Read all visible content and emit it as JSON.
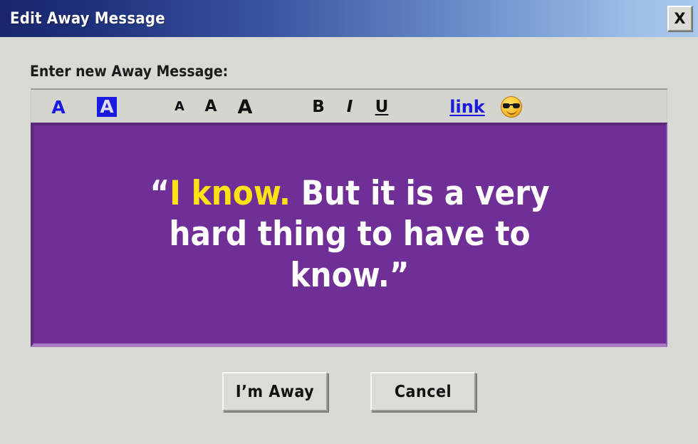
{
  "window": {
    "title": "Edit Away Message",
    "close_label": "X",
    "titlebar_gradient_from": "#19266b",
    "titlebar_gradient_to": "#a9c8ec",
    "body_background": "#d9d9d3"
  },
  "form": {
    "prompt_label": "Enter new Away Message:"
  },
  "toolbar": {
    "font_color_label": "A",
    "background_color_label": "A",
    "size_small_label": "A",
    "size_medium_label": "A",
    "size_large_label": "A",
    "bold_label": "B",
    "italic_label": "I",
    "underline_label": "U",
    "link_label": "link",
    "emoji_label": "sunglasses-smiley",
    "accent_color": "#1a1ae0",
    "background": "#d5d5cf"
  },
  "message": {
    "background_color": "#6f2f96",
    "default_text_color": "#ffffff",
    "highlight_color": "#ffe213",
    "open_quote": "“",
    "highlighted_text": "I know.",
    "rest_text": " But it is a very hard thing to have to know.",
    "close_quote": "”",
    "full_text": "“I know. But it is a very hard thing to have to know.”"
  },
  "buttons": {
    "confirm_label": "I’m Away",
    "cancel_label": "Cancel"
  }
}
